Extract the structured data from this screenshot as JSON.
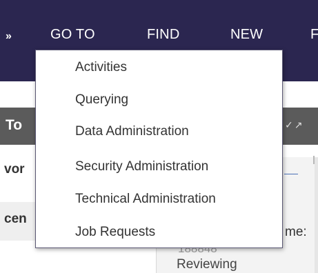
{
  "nav": {
    "chevron": "»",
    "items": [
      {
        "label": "GO TO"
      },
      {
        "label": "FIND"
      },
      {
        "label": "NEW"
      },
      {
        "label": "F"
      }
    ]
  },
  "panel": {
    "title": "To",
    "icons": [
      "check-icon",
      "expand-icon"
    ]
  },
  "background_text": {
    "left_1": "vor",
    "left_2": "cen",
    "right_label": "me:",
    "right_cut_value": "188848",
    "right_status": "Reviewing"
  },
  "dropdown": {
    "items": [
      {
        "label": "Activities"
      },
      {
        "label": "Querying"
      },
      {
        "label": "Data Administration"
      },
      {
        "label": "Security Administration"
      },
      {
        "label": "Technical Administration"
      },
      {
        "label": "Job Requests"
      }
    ]
  },
  "colors": {
    "nav_bg": "#2b2650",
    "panel_header_bg": "#5b5b5b",
    "menu_border": "#5a5773"
  }
}
